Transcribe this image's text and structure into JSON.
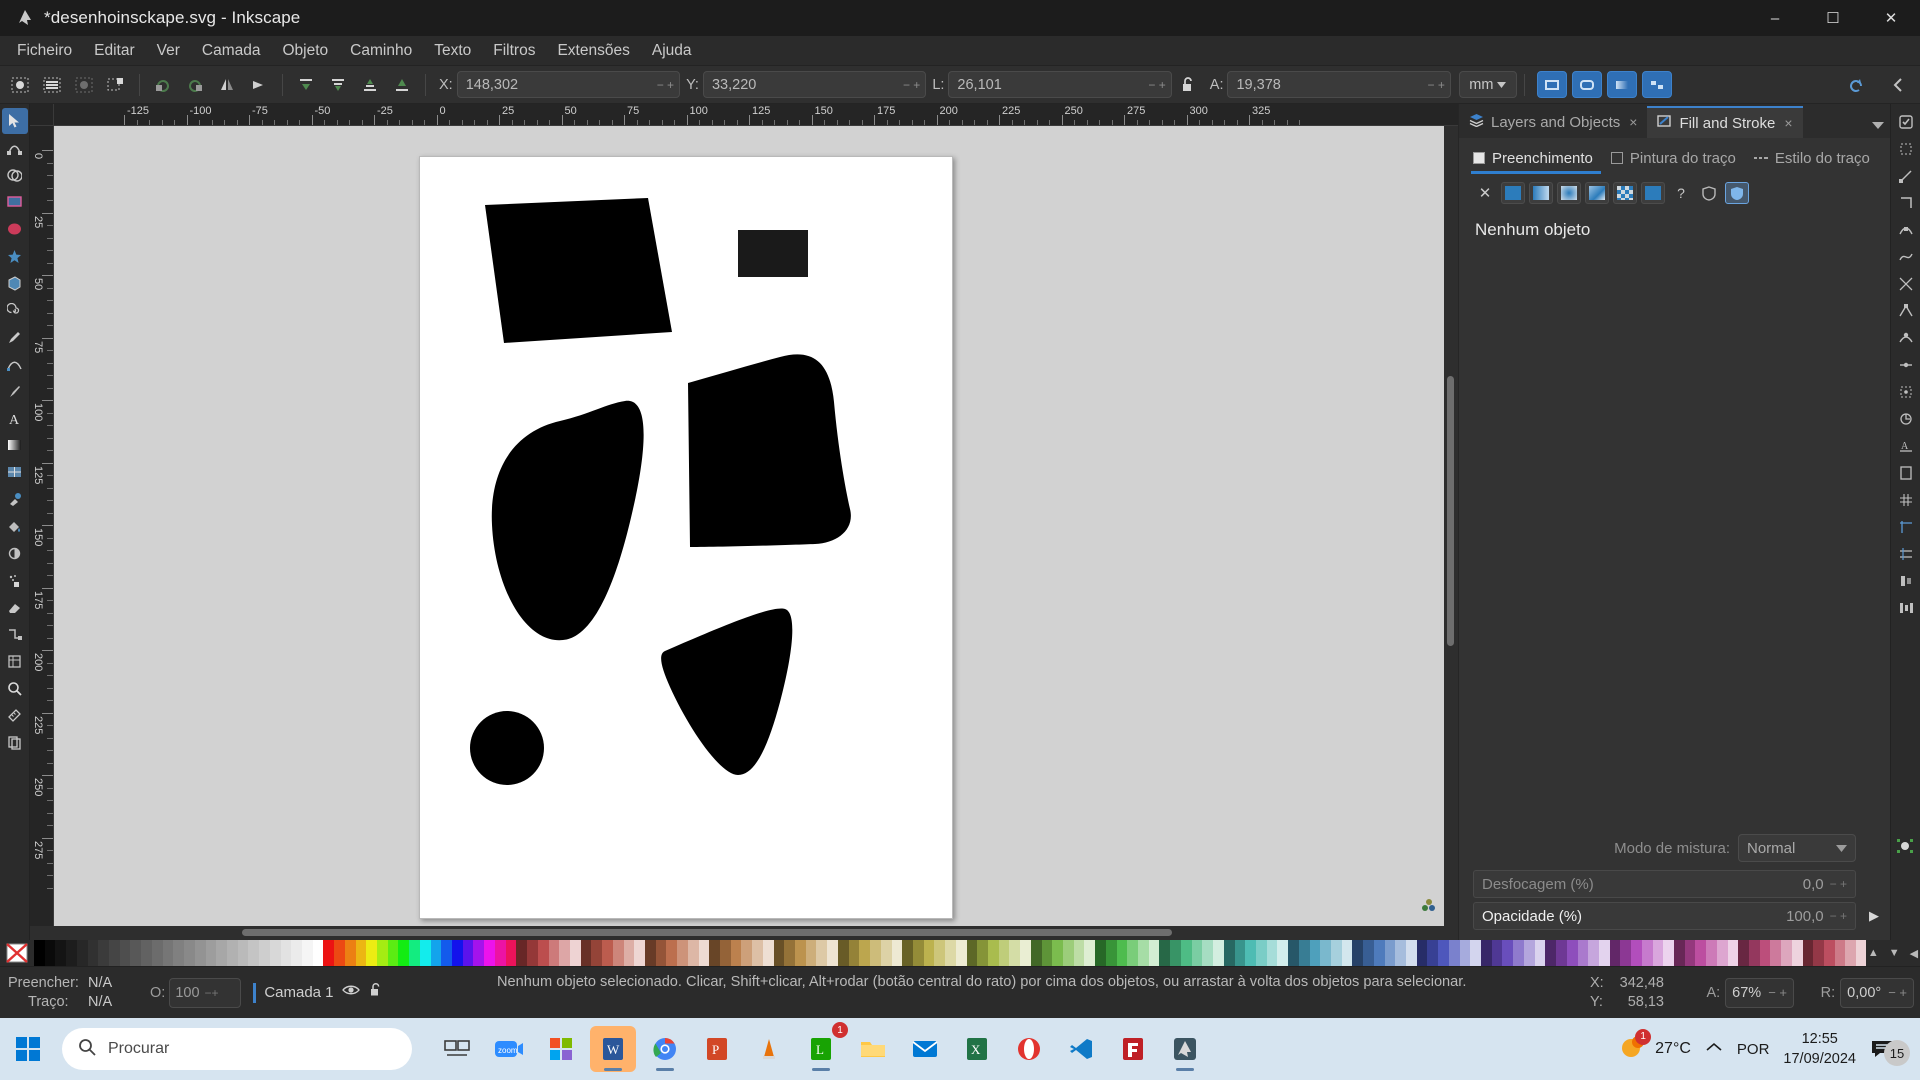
{
  "window": {
    "title": "*desenhoinsckape.svg - Inkscape",
    "app_icon": "inkscape-logo-icon",
    "minimize": "–",
    "maximize": "☐",
    "close": "✕"
  },
  "menubar": {
    "items": [
      {
        "label": "Ficheiro"
      },
      {
        "label": "Editar"
      },
      {
        "label": "Ver"
      },
      {
        "label": "Camada"
      },
      {
        "label": "Objeto"
      },
      {
        "label": "Caminho"
      },
      {
        "label": "Texto"
      },
      {
        "label": "Filtros"
      },
      {
        "label": "Extensões"
      },
      {
        "label": "Ajuda"
      }
    ]
  },
  "toolbar": {
    "icons_left": [
      "select-all-icon",
      "select-all-layers-icon",
      "deselect-icon",
      "select-same-icon"
    ],
    "icons_transform": [
      "rotate-ccw-icon",
      "rotate-cw-icon",
      "flip-horizontal-icon",
      "flip-vertical-icon"
    ],
    "icons_zorder": [
      "raise-to-top-icon",
      "raise-icon",
      "lower-icon",
      "lower-to-bottom-icon"
    ],
    "x_label": "X:",
    "x_value": "148,302",
    "y_label": "Y:",
    "y_value": "33,220",
    "w_label": "L:",
    "w_value": "26,101",
    "lock_icon": "lock-open-icon",
    "h_label": "A:",
    "h_value": "19,378",
    "unit_value": "mm",
    "affect_buttons": [
      "affect-stroke-width-icon",
      "affect-rounded-corners-icon",
      "affect-gradients-icon",
      "affect-patterns-icon"
    ],
    "history_icon": "undo-history-icon",
    "overflow_icon": "chevron-left-icon"
  },
  "toolbox": {
    "tools": [
      {
        "name": "selector-tool",
        "glyph": "➤",
        "active": true
      },
      {
        "name": "node-tool",
        "glyph": "⬚"
      },
      {
        "name": "shape-builder-tool",
        "glyph": "◑"
      },
      {
        "name": "rectangle-tool",
        "glyph": "▬"
      },
      {
        "name": "ellipse-tool",
        "glyph": "⬭"
      },
      {
        "name": "star-tool",
        "glyph": "★"
      },
      {
        "name": "3dbox-tool",
        "glyph": "▣"
      },
      {
        "name": "spiral-tool",
        "glyph": "◌"
      },
      {
        "name": "pencil-tool",
        "glyph": "✎"
      },
      {
        "name": "bezier-tool",
        "glyph": "✒"
      },
      {
        "name": "calligraphy-tool",
        "glyph": "✐"
      },
      {
        "name": "text-tool",
        "glyph": "A"
      },
      {
        "name": "gradient-tool",
        "glyph": "▤"
      },
      {
        "name": "mesh-tool",
        "glyph": "▦"
      },
      {
        "name": "dropper-tool",
        "glyph": "⚗"
      },
      {
        "name": "paintbucket-tool",
        "glyph": "◢"
      },
      {
        "name": "tweak-tool",
        "glyph": "◕"
      },
      {
        "name": "spray-tool",
        "glyph": "⁂"
      },
      {
        "name": "eraser-tool",
        "glyph": "◧"
      },
      {
        "name": "connector-tool",
        "glyph": "⤵"
      },
      {
        "name": "lpe-tool",
        "glyph": "⌗"
      },
      {
        "name": "zoom-tool",
        "glyph": "⌕"
      },
      {
        "name": "measure-tool",
        "glyph": "◰"
      },
      {
        "name": "pages-tool",
        "glyph": "❐"
      }
    ]
  },
  "rulers": {
    "unit": "mm",
    "h_labels": [
      "-125",
      "-100",
      "-75",
      "-50",
      "-25",
      "0",
      "25",
      "50",
      "75",
      "100",
      "125",
      "150",
      "175",
      "200",
      "225",
      "250",
      "275",
      "300",
      "325"
    ],
    "v_labels": [
      "0",
      "25",
      "50",
      "75",
      "100",
      "125",
      "150",
      "175",
      "200",
      "225",
      "250",
      "275"
    ]
  },
  "canvas": {
    "desk_color": "#d2d2d2",
    "page_color": "#ffffff",
    "shapes": [
      {
        "name": "quadrilateral-top-left",
        "fill": "#000000"
      },
      {
        "name": "small-rectangle-top-right",
        "fill": "#1a1a1a"
      },
      {
        "name": "teardrop-blob-left",
        "fill": "#000000"
      },
      {
        "name": "hat-shape-right",
        "fill": "#000000"
      },
      {
        "name": "triangle-blob-bottom",
        "fill": "#000000"
      },
      {
        "name": "circle-bottom-left",
        "fill": "#000000"
      }
    ],
    "monitor_icon": "display-toggle-icon",
    "snap_indicator_icon": "snap-indicator-icon"
  },
  "dock": {
    "tabs": [
      {
        "label": "Layers and Objects",
        "icon": "layers-icon",
        "close": "×",
        "active": false
      },
      {
        "label": "Fill and Stroke",
        "icon": "fill-stroke-icon",
        "close": "×",
        "active": true
      }
    ],
    "menu_icon": "chevron-down-icon",
    "fill_stroke_tabs": [
      {
        "label": "Preenchimento",
        "icon": "fill-square-icon",
        "active": true
      },
      {
        "label": "Pintura do traço",
        "icon": "stroke-square-icon",
        "active": false
      },
      {
        "label": "Estilo do traço",
        "icon": "stroke-style-icon",
        "active": false
      }
    ],
    "paint_buttons": [
      {
        "name": "no-paint-button",
        "glyph": "✕",
        "kind": "x"
      },
      {
        "name": "flat-color-button",
        "kind": "flat",
        "selected": false
      },
      {
        "name": "linear-gradient-button",
        "kind": "lin"
      },
      {
        "name": "radial-gradient-button",
        "kind": "rad"
      },
      {
        "name": "mesh-gradient-button",
        "kind": "mesh"
      },
      {
        "name": "pattern-button",
        "kind": "pat"
      },
      {
        "name": "swatch-button",
        "kind": "flat"
      },
      {
        "name": "unknown-paint-button",
        "glyph": "?",
        "kind": "x"
      },
      {
        "name": "fill-rule-nonzero-button",
        "glyph": "⬟",
        "kind": "shield"
      },
      {
        "name": "fill-rule-evenodd-button",
        "glyph": "⬟",
        "kind": "shield",
        "selected": true
      }
    ],
    "empty_message": "Nenhum objeto",
    "blend_label": "Modo de mistura:",
    "blend_value": "Normal",
    "blur_label": "Desfocagem (%)",
    "blur_value": "0,0",
    "opacity_label": "Opacidade (%)",
    "opacity_value": "100,0",
    "object_props_icon": "object-properties-icon",
    "expand_icon": "expand-arrow-icon"
  },
  "snapbar": {
    "icons": [
      "snap-enable-icon",
      "snap-bbox-icon",
      "snap-bbox-edge-icon",
      "snap-bbox-corner-icon",
      "snap-node-icon",
      "snap-path-icon",
      "snap-path-intersection-icon",
      "snap-cusp-node-icon",
      "snap-smooth-node-icon",
      "snap-midpoint-icon",
      "snap-object-center-icon",
      "snap-rotation-center-icon",
      "snap-text-baseline-icon",
      "snap-page-border-icon",
      "snap-grid-icon",
      "snap-guide-icon",
      "snap-grid-guide-icon",
      "snap-align-icon",
      "snap-distribute-icon"
    ]
  },
  "palette": {
    "no_fill_icon": "no-color-x-icon",
    "scroll_up_icon": "chevron-up-icon",
    "scroll_down_icon": "chevron-down-icon",
    "menu_icon": "palette-menu-icon"
  },
  "statusbar": {
    "fill_label": "Preencher:",
    "fill_value": "N/A",
    "stroke_label": "Traço:",
    "stroke_value": "N/A",
    "opacity_label": "O:",
    "opacity_value": "100",
    "layer_name": "Camada 1",
    "layer_visibility_icon": "eye-icon",
    "layer_lock_icon": "lock-open-icon",
    "message": "Nenhum objeto selecionado. Clicar, Shift+clicar, Alt+rodar (botão central do rato) por cima dos objetos, ou arrastar à volta dos objetos para selecionar.",
    "x_label": "X:",
    "x_value": "342,48",
    "y_label": "Y:",
    "y_value": "58,13",
    "zoom_label": "A:",
    "zoom_value": "67%",
    "rotation_label": "R:",
    "rotation_value": "0,00°",
    "minus": "−",
    "plus": "+"
  },
  "taskbar": {
    "start_icon": "windows-start-icon",
    "search_placeholder": "Procurar",
    "search_icon": "search-icon",
    "items": [
      {
        "name": "task-view-button",
        "icon": "task-view-icon",
        "color": "#3c3c3c"
      },
      {
        "name": "zoom-app",
        "icon": "zoom-icon",
        "color": "#2d8cff",
        "label": "zoom"
      },
      {
        "name": "microsoft-store-app",
        "icon": "store-icon",
        "color": "#8a63d2"
      },
      {
        "name": "word-app",
        "icon": "word-icon",
        "color": "#2b579a",
        "active": true
      },
      {
        "name": "chrome-app",
        "icon": "chrome-icon",
        "color": "#4285f4"
      },
      {
        "name": "powerpoint-app",
        "icon": "powerpoint-icon",
        "color": "#d24726"
      },
      {
        "name": "vlc-app",
        "icon": "vlc-cone-icon",
        "color": "#e8730c"
      },
      {
        "name": "libreoffice-app",
        "icon": "libreoffice-icon",
        "color": "#18a303",
        "badge": "1"
      },
      {
        "name": "file-explorer-app",
        "icon": "folder-icon",
        "color": "#ffc845"
      },
      {
        "name": "mail-app",
        "icon": "mail-icon",
        "color": "#0078d4"
      },
      {
        "name": "excel-app",
        "icon": "excel-icon",
        "color": "#217346"
      },
      {
        "name": "opera-app",
        "icon": "opera-icon",
        "color": "#e2342f"
      },
      {
        "name": "vscode-app",
        "icon": "vscode-icon",
        "color": "#0f7ac7"
      },
      {
        "name": "filezilla-app",
        "icon": "filezilla-icon",
        "color": "#bf2026"
      },
      {
        "name": "inkscape-app",
        "icon": "inkscape-icon",
        "color": "#3b5461",
        "running": true
      }
    ],
    "tray": {
      "temperature": "27°C",
      "weather_badge": "1",
      "overflow_icon": "chevron-up-icon",
      "language": "POR",
      "time": "12:55",
      "date": "17/09/2024",
      "notification_count": "15",
      "notification_icon": "notification-icon"
    }
  }
}
